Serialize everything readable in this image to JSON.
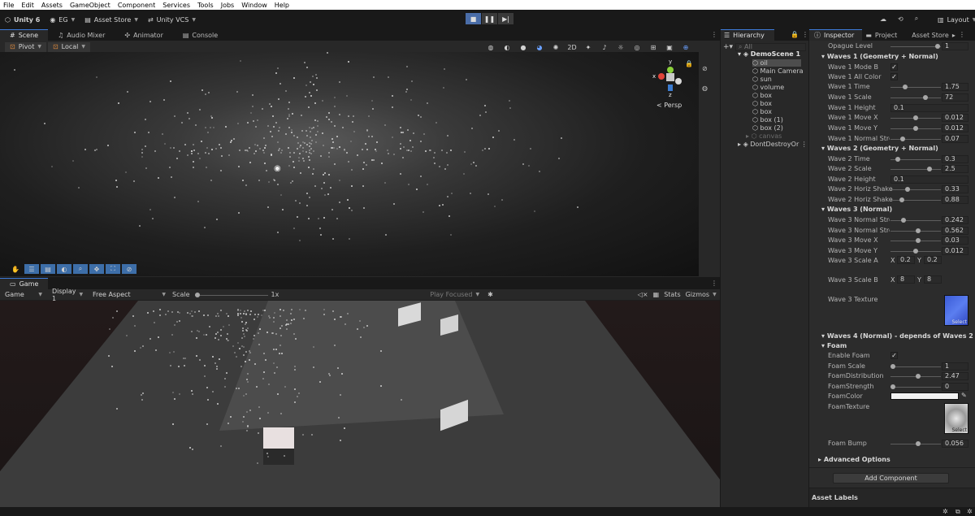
{
  "menubar": [
    "File",
    "Edit",
    "Assets",
    "GameObject",
    "Component",
    "Services",
    "Tools",
    "Jobs",
    "Window",
    "Help"
  ],
  "toolbar": {
    "unity_version": "Unity 6",
    "account": "EG",
    "asset_store": "Asset Store",
    "vcs": "Unity VCS",
    "layout": "Layout"
  },
  "scene_tabs": [
    "Scene",
    "Audio Mixer",
    "Animator",
    "Console"
  ],
  "scene_toolbar": {
    "pivot": "Pivot",
    "space": "Local",
    "persp_label": "< Persp"
  },
  "gizmo_axes": {
    "x": "x",
    "y": "y",
    "z": "z"
  },
  "game_tab": "Game",
  "game_toolbar": {
    "view_mode": "Game",
    "display": "Display 1",
    "aspect": "Free Aspect",
    "scale_label": "Scale",
    "scale_value": "1x",
    "play_mode": "Play Focused",
    "stats": "Stats",
    "gizmos": "Gizmos"
  },
  "hierarchy": {
    "title": "Hierarchy",
    "search_placeholder": "All",
    "scene_name": "DemoScene 1",
    "items": [
      "oil",
      "Main Camera",
      "sun",
      "volume",
      "box",
      "box",
      "box",
      "box (1)",
      "box (2)",
      "canvas"
    ],
    "dont_destroy": "DontDestroyOr"
  },
  "inspector_tabs": [
    "Inspector",
    "Project",
    "Asset Store"
  ],
  "inspector": {
    "opaque_level": {
      "label": "Opague Level",
      "value": "1"
    },
    "wave1_header": "Waves 1 (Geometry + Normal)",
    "wave1_mode_b": "Wave 1 Mode B",
    "wave1_all_color": "Wave 1 All Color",
    "wave1_time": {
      "label": "Wave 1 Time",
      "value": "1.75"
    },
    "wave1_scale": {
      "label": "Wave 1 Scale",
      "value": "72"
    },
    "wave1_height": {
      "label": "Wave 1 Height",
      "value": "0.1"
    },
    "wave1_move_x": {
      "label": "Wave 1 Move X",
      "value": "0.012"
    },
    "wave1_move_y": {
      "label": "Wave 1 Move Y",
      "value": "0.012"
    },
    "wave1_normal": {
      "label": "Wave 1 Normal Streng",
      "value": "0.07"
    },
    "wave2_header": "Waves 2 (Geometry + Normal)",
    "wave2_time": {
      "label": "Wave 2 Time",
      "value": "0.3"
    },
    "wave2_scale": {
      "label": "Wave 2 Scale",
      "value": "2.5"
    },
    "wave2_height": {
      "label": "Wave 2 Height",
      "value": "0.1"
    },
    "wave2_shake1": {
      "label": "Wave 2 Horiz Shake",
      "value": "0.33"
    },
    "wave2_shake2": {
      "label": "Wave 2 Horiz Shake",
      "value": "0.88"
    },
    "wave3_header": "Waves 3 (Normal)",
    "wave3_normal1": {
      "label": "Wave 3 Normal Streng",
      "value": "0.242"
    },
    "wave3_normal2": {
      "label": "Wave 3 Normal Streng",
      "value": "0.562"
    },
    "wave3_move_x": {
      "label": "Wave 3 Move X",
      "value": "0.03"
    },
    "wave3_move_y": {
      "label": "Wave 3 Move Y",
      "value": "0.012"
    },
    "wave3_scale_a": {
      "label": "Wave 3 Scale A",
      "x": "0.2",
      "y": "0.2"
    },
    "wave3_scale_b": {
      "label": "Wave 3 Scale B",
      "x": "8",
      "y": "8"
    },
    "wave3_texture": "Wave 3 Texture",
    "select": "Select",
    "wave4_header": "Waves 4 (Normal) - depends of Waves 2",
    "foam_header": "Foam",
    "enable_foam": "Enable Foam",
    "foam_scale": {
      "label": "Foam Scale",
      "value": "1"
    },
    "foam_distribution": {
      "label": "FoamDistribution",
      "value": "2.47"
    },
    "foam_strength": {
      "label": "FoamStrength",
      "value": "0"
    },
    "foam_color": "FoamColor",
    "foam_texture": "FoamTexture",
    "foam_bump": {
      "label": "Foam Bump",
      "value": "0.056"
    },
    "advanced": "Advanced Options",
    "add_component": "Add Component",
    "asset_labels": "Asset Labels"
  },
  "xy": {
    "x": "X",
    "y": "Y"
  },
  "colors": {
    "accent": "#3d7bd9",
    "panel": "#282828",
    "background": "#191919"
  }
}
